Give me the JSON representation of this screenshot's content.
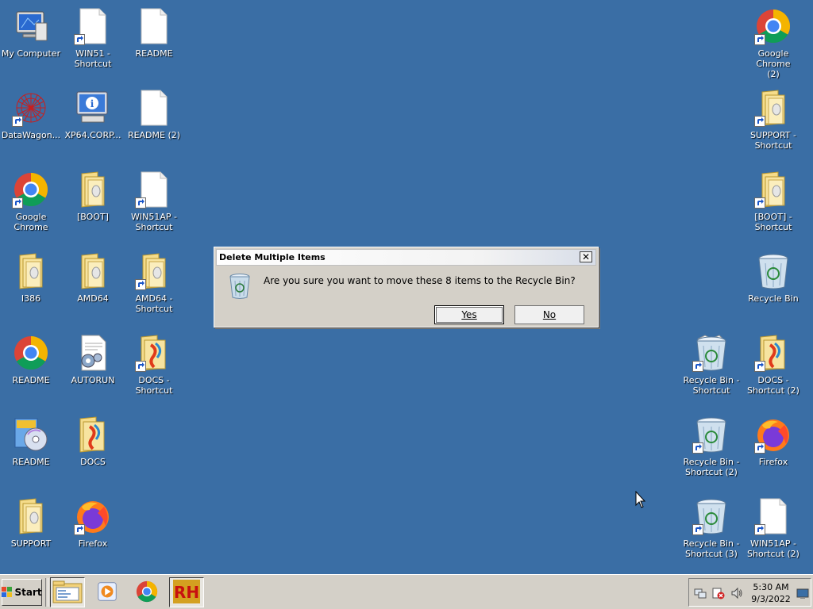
{
  "desktop": {
    "icons": [
      {
        "label": "My Computer",
        "icon": "my-computer-icon",
        "shortcut": false
      },
      {
        "label": "WIN51 -\nShortcut",
        "icon": "document-icon",
        "shortcut": true
      },
      {
        "label": "README",
        "icon": "document-icon",
        "shortcut": false
      },
      {
        "label": "DataWagon...",
        "icon": "datawagon-icon",
        "shortcut": true
      },
      {
        "label": "XP64.CORP...",
        "icon": "info-computer-icon",
        "shortcut": false
      },
      {
        "label": "README  (2)",
        "icon": "document-icon",
        "shortcut": false
      },
      {
        "label": "Google Chrome",
        "icon": "chrome-icon",
        "shortcut": true
      },
      {
        "label": "[BOOT]",
        "icon": "folder-icon",
        "shortcut": false
      },
      {
        "label": "WIN51AP -\nShortcut",
        "icon": "document-icon",
        "shortcut": true
      },
      {
        "label": "I386",
        "icon": "folder-icon",
        "shortcut": false
      },
      {
        "label": "AMD64",
        "icon": "folder-icon",
        "shortcut": false
      },
      {
        "label": "AMD64 -\nShortcut",
        "icon": "folder-icon",
        "shortcut": true
      },
      {
        "label": "README",
        "icon": "chrome-icon",
        "shortcut": false
      },
      {
        "label": "AUTORUN",
        "icon": "config-file-icon",
        "shortcut": false
      },
      {
        "label": "DOCS -\nShortcut",
        "icon": "docs-folder-icon",
        "shortcut": true
      },
      {
        "label": "README",
        "icon": "setup-cd-icon",
        "shortcut": false
      },
      {
        "label": "DOCS",
        "icon": "docs-folder-icon",
        "shortcut": false
      },
      {
        "label": "SUPPORT",
        "icon": "folder-icon",
        "shortcut": false
      },
      {
        "label": "Firefox",
        "icon": "firefox-icon",
        "shortcut": true
      },
      {
        "label": "Google Chrome\n(2)",
        "icon": "chrome-icon",
        "shortcut": true
      },
      {
        "label": "SUPPORT -\nShortcut",
        "icon": "folder-icon",
        "shortcut": true
      },
      {
        "label": "[BOOT] -\nShortcut",
        "icon": "folder-icon",
        "shortcut": true
      },
      {
        "label": "Recycle Bin",
        "icon": "recycle-bin-icon",
        "shortcut": false
      },
      {
        "label": "Recycle Bin -\nShortcut",
        "icon": "recycle-bin-full-icon",
        "shortcut": true
      },
      {
        "label": "DOCS -\nShortcut (2)",
        "icon": "docs-folder-icon",
        "shortcut": true
      },
      {
        "label": "Recycle Bin -\nShortcut (2)",
        "icon": "recycle-bin-icon",
        "shortcut": true
      },
      {
        "label": "Firefox",
        "icon": "firefox-icon",
        "shortcut": true
      },
      {
        "label": "Recycle Bin -\nShortcut (3)",
        "icon": "recycle-bin-icon",
        "shortcut": true
      },
      {
        "label": "WIN51AP -\nShortcut (2)",
        "icon": "document-icon",
        "shortcut": true
      }
    ]
  },
  "dialog": {
    "title": "Delete Multiple Items",
    "close_glyph": "✕",
    "message": "Are you sure you want to move these 8 items to the Recycle Bin?",
    "yes_label": "Yes",
    "no_label": "No"
  },
  "taskbar": {
    "start_label": "Start",
    "quick_launch": [
      "explorer-icon",
      "media-player-icon",
      "chrome-icon",
      "rh-icon"
    ],
    "tray_icons": [
      "network-icon",
      "security-alert-icon",
      "volume-icon"
    ],
    "clock_time": "5:30 AM",
    "clock_date": "9/3/2022"
  },
  "colors": {
    "desktop_bg": "#3a6ea5",
    "taskbar_bg": "#d4d0c8"
  }
}
